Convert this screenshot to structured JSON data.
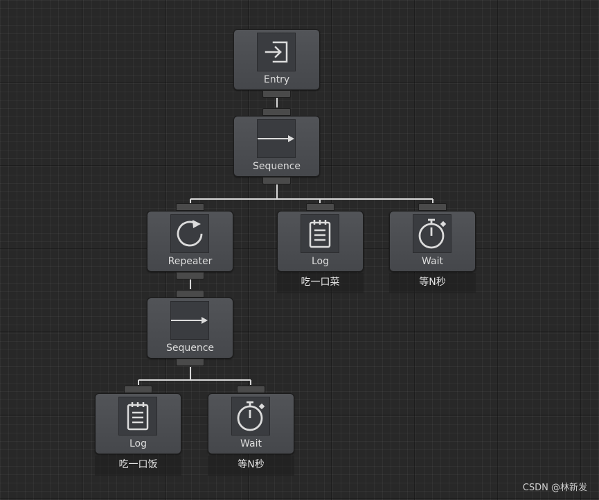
{
  "nodes": {
    "entry": {
      "label": "Entry",
      "icon": "entry-icon"
    },
    "sequence_root": {
      "label": "Sequence",
      "icon": "arrow-right-icon"
    },
    "repeater": {
      "label": "Repeater",
      "icon": "repeat-icon"
    },
    "log_top": {
      "label": "Log",
      "icon": "notepad-icon",
      "comment": "吃一口菜"
    },
    "wait_top": {
      "label": "Wait",
      "icon": "stopwatch-icon",
      "comment": "等N秒"
    },
    "sequence_child": {
      "label": "Sequence",
      "icon": "arrow-right-icon"
    },
    "log_bottom": {
      "label": "Log",
      "icon": "notepad-icon",
      "comment": "吃一口饭"
    },
    "wait_bottom": {
      "label": "Wait",
      "icon": "stopwatch-icon",
      "comment": "等N秒"
    }
  },
  "colors": {
    "background": "#282828",
    "node": "#4b4d51",
    "edge": "#d8d8d8",
    "text": "#dcdcdc"
  },
  "watermark": "CSDN @林新发"
}
